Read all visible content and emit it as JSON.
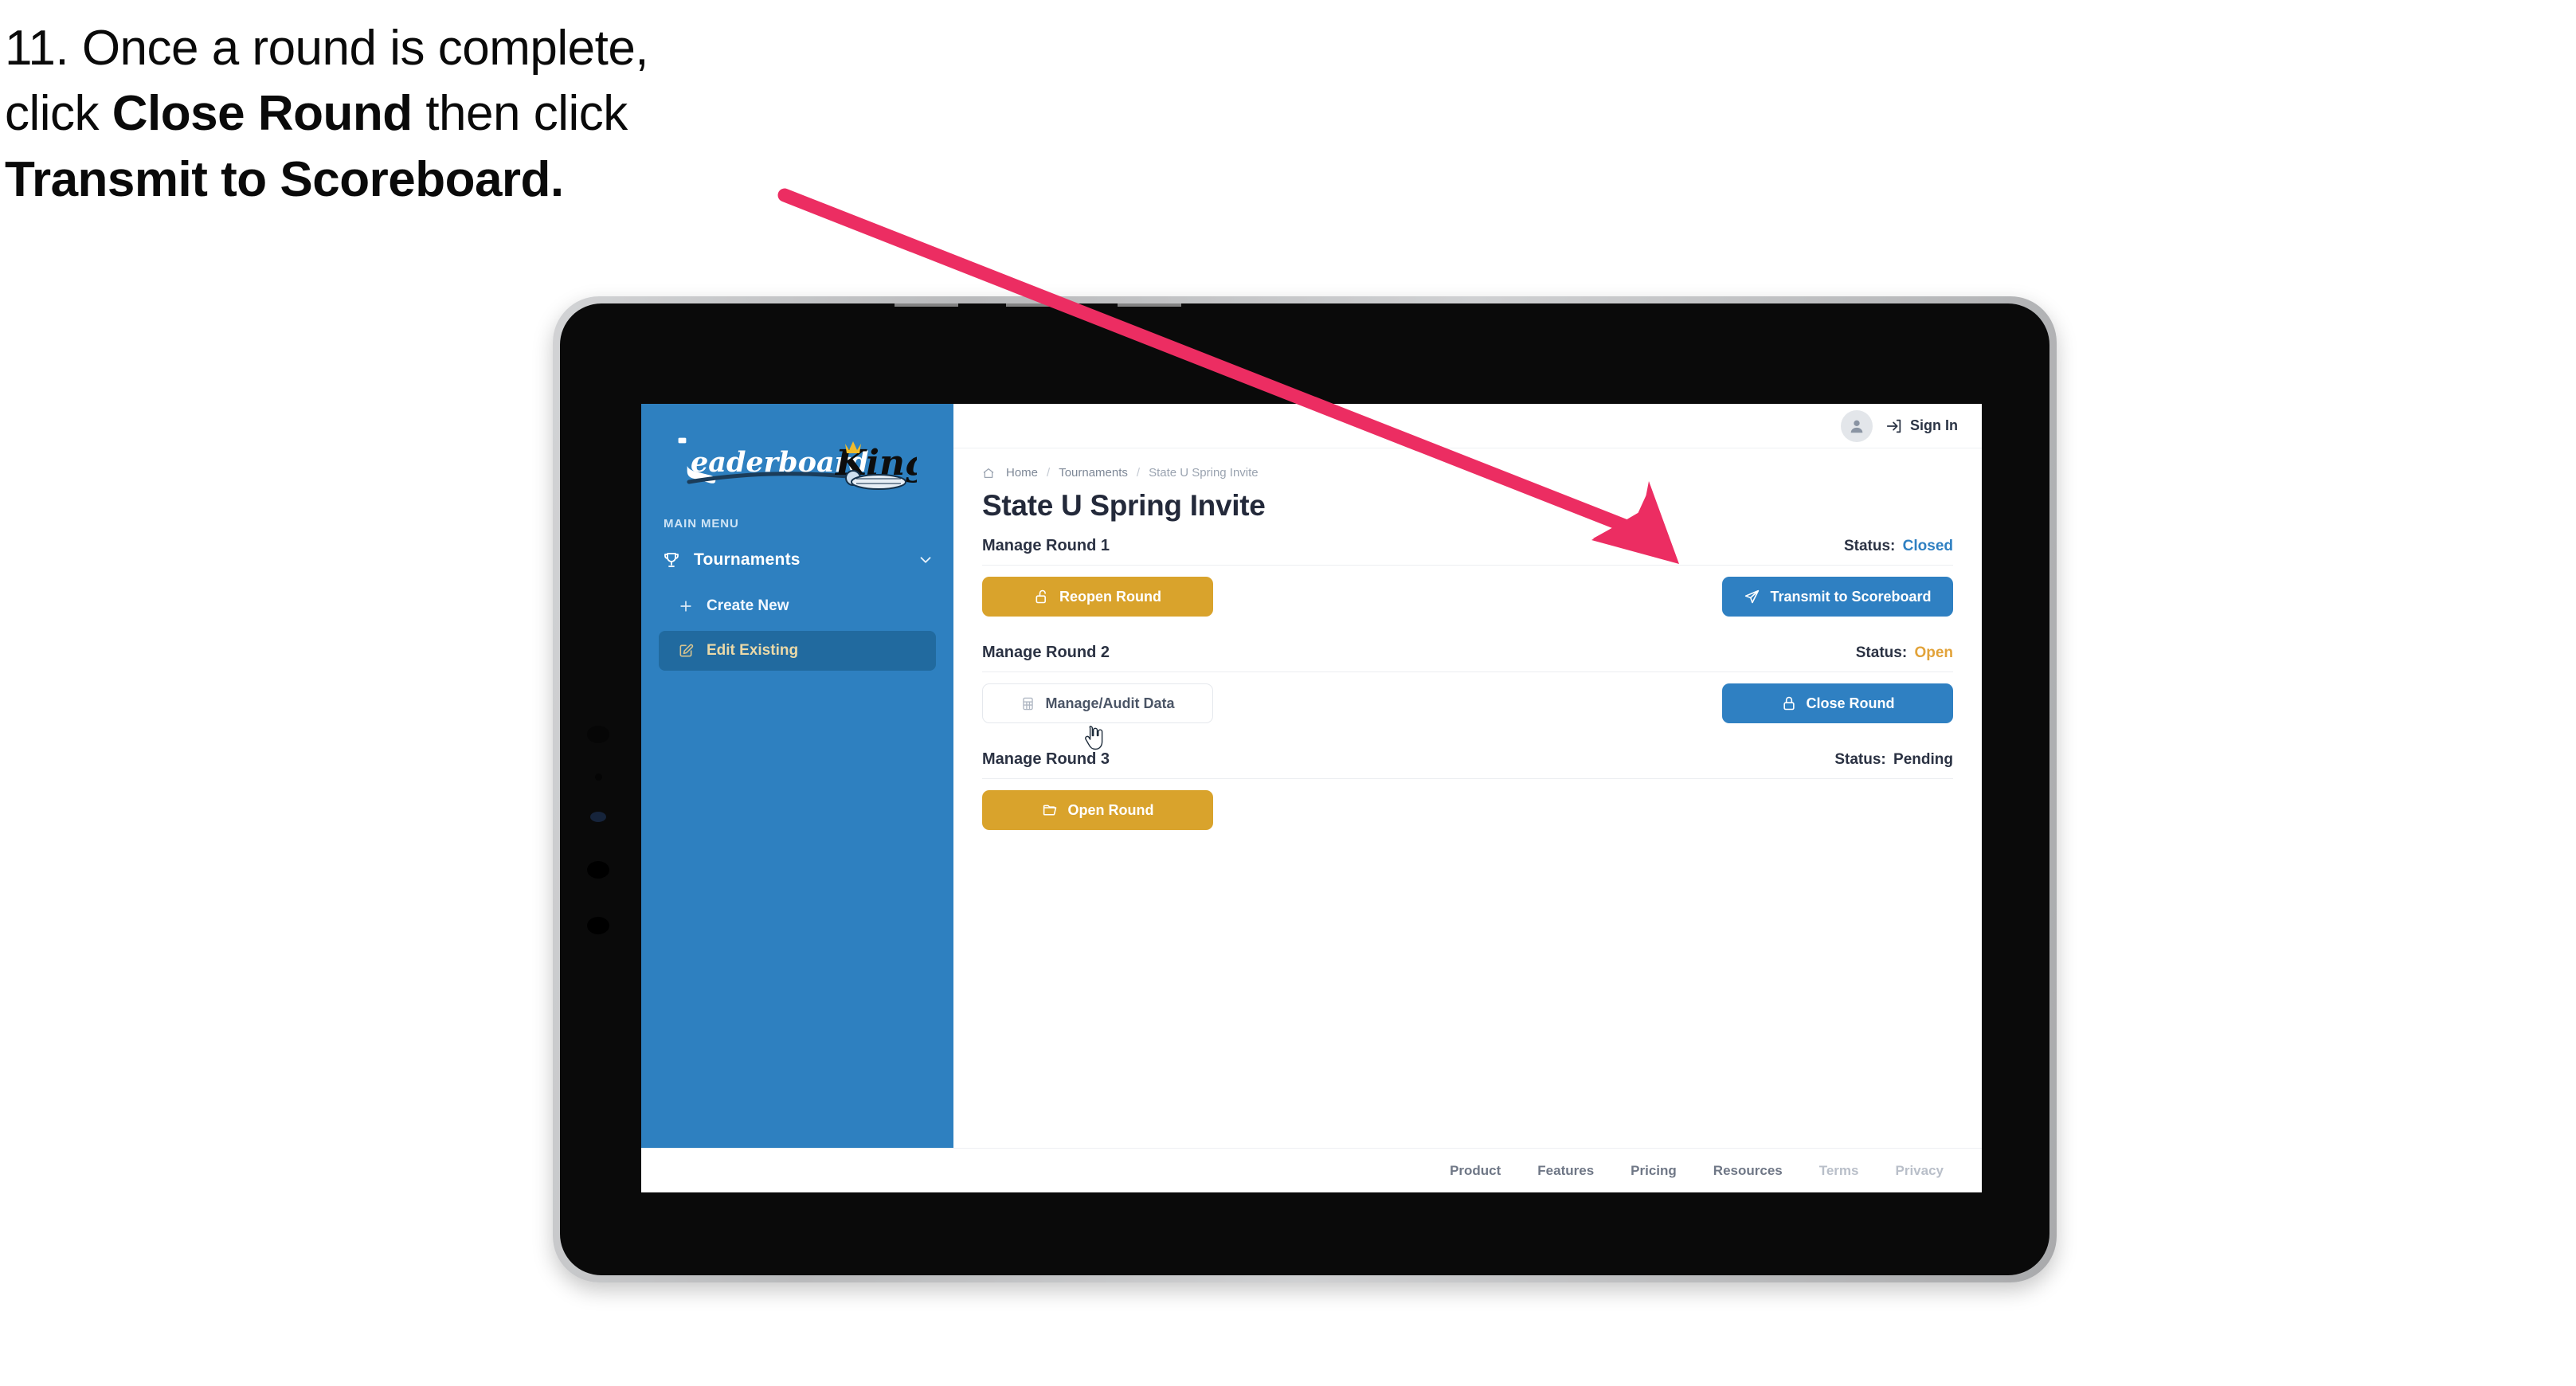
{
  "caption": {
    "line1_plain": "11. Once a round is complete,",
    "line2_pre": "click ",
    "line2_bold": "Close Round",
    "line2_post": " then click",
    "line3_bold": "Transmit to Scoreboard."
  },
  "annotation": {
    "arrow_color": "#ec2d62",
    "points_to": "transmit-to-scoreboard-button"
  },
  "sidebar": {
    "logo_text_primary": "Leaderboard",
    "logo_text_secondary": "King",
    "section_label": "MAIN MENU",
    "nav": {
      "label": "Tournaments",
      "icon": "trophy-icon",
      "chevron": "chevron-down-icon"
    },
    "items": [
      {
        "label": "Create New",
        "icon": "plus-icon",
        "active": false
      },
      {
        "label": "Edit Existing",
        "icon": "edit-square-icon",
        "active": true
      }
    ],
    "bg_color": "#2e80c0",
    "active_bg_color": "#216a9f",
    "active_text_color": "#ead9a8"
  },
  "topbar": {
    "avatar_icon": "user-avatar-icon",
    "signin_icon": "sign-in-arrow-icon",
    "signin_label": "Sign In"
  },
  "breadcrumb": {
    "home_icon": "home-icon",
    "items": [
      "Home",
      "Tournaments",
      "State U Spring Invite"
    ],
    "separator": "/"
  },
  "page": {
    "title": "State U Spring Invite"
  },
  "rounds": [
    {
      "name": "Manage Round 1",
      "status_label": "Status:",
      "status_value": "Closed",
      "status_class": "v-closed",
      "left_button": {
        "label": "Reopen Round",
        "icon": "unlock-icon",
        "style": "gold"
      },
      "right_button": {
        "label": "Transmit to Scoreboard",
        "icon": "paper-plane-icon",
        "style": "blue"
      }
    },
    {
      "name": "Manage Round 2",
      "status_label": "Status:",
      "status_value": "Open",
      "status_class": "v-open",
      "left_button": {
        "label": "Manage/Audit Data",
        "icon": "table-grid-icon",
        "style": "ghost"
      },
      "right_button": {
        "label": "Close Round",
        "icon": "lock-icon",
        "style": "blue"
      }
    },
    {
      "name": "Manage Round 3",
      "status_label": "Status:",
      "status_value": "Pending",
      "status_class": "v-pending",
      "left_button": {
        "label": "Open Round",
        "icon": "folder-open-icon",
        "style": "gold"
      },
      "right_button": null
    }
  ],
  "footer": {
    "links": [
      {
        "label": "Product",
        "dim": false
      },
      {
        "label": "Features",
        "dim": false
      },
      {
        "label": "Pricing",
        "dim": false
      },
      {
        "label": "Resources",
        "dim": false
      },
      {
        "label": "Terms",
        "dim": true
      },
      {
        "label": "Privacy",
        "dim": true
      }
    ]
  },
  "colors": {
    "brand_blue": "#2f80c2",
    "gold": "#d9a32c",
    "status_open": "#e2a33a",
    "annotation_pink": "#ec2d62"
  }
}
